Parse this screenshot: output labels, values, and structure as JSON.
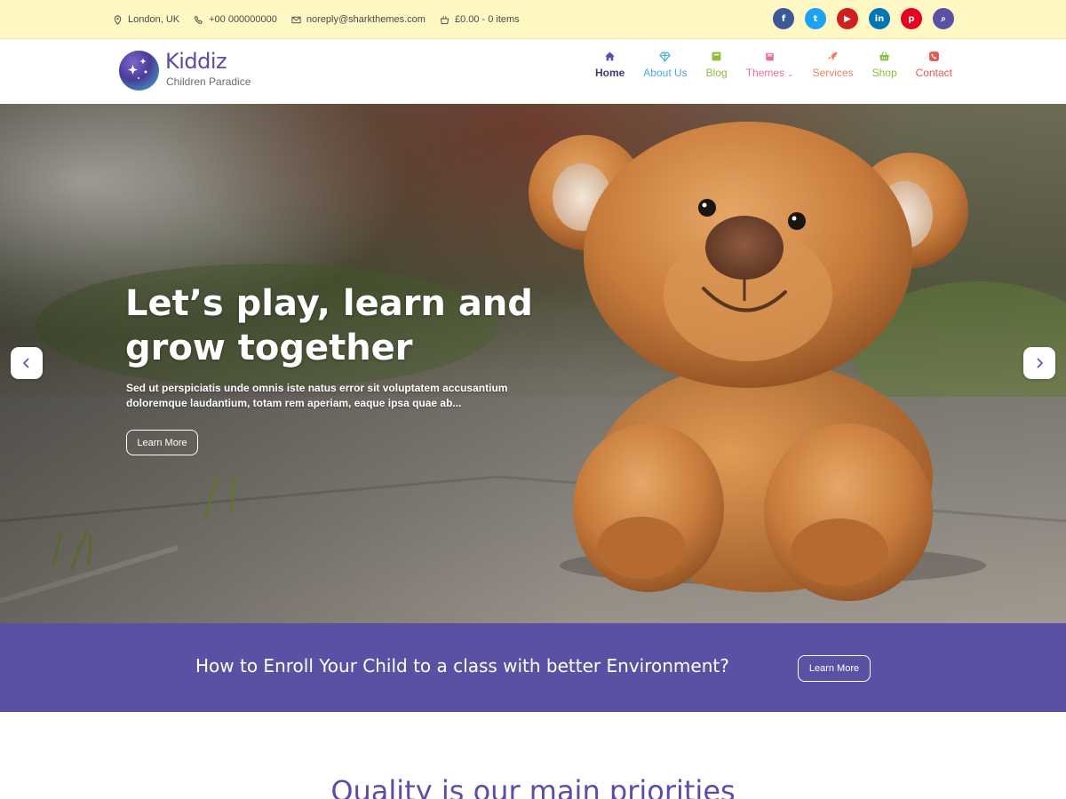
{
  "topbar": {
    "location": "London, UK",
    "phone": "+00 000000000",
    "email": "noreply@sharkthemes.com",
    "cart": "£0.00 - 0 items",
    "socials": [
      {
        "name": "facebook",
        "glyph": "f",
        "color": "#3b5998"
      },
      {
        "name": "twitter",
        "glyph": "t",
        "color": "#1da1f2"
      },
      {
        "name": "youtube",
        "glyph": "▶",
        "color": "#cd201f"
      },
      {
        "name": "linkedin",
        "glyph": "in",
        "color": "#0077b5"
      },
      {
        "name": "pinterest",
        "glyph": "p",
        "color": "#e60023"
      },
      {
        "name": "search",
        "glyph": "⌕",
        "color": "#5b51a4"
      }
    ]
  },
  "brand": {
    "title": "Kiddiz",
    "subtitle": "Children Paradice"
  },
  "nav": {
    "items": [
      {
        "label": "Home",
        "icon": "home-icon",
        "color": "#3d3a73"
      },
      {
        "label": "About Us",
        "icon": "diamond-icon",
        "color": "#4aa9d9"
      },
      {
        "label": "Blog",
        "icon": "blog-icon",
        "color": "#8bbf3c"
      },
      {
        "label": "Themes",
        "icon": "book-icon",
        "color": "#e7718f"
      },
      {
        "label": "Services",
        "icon": "rocket-icon",
        "color": "#e8845f"
      },
      {
        "label": "Shop",
        "icon": "basket-icon",
        "color": "#8bbf3c"
      },
      {
        "label": "Contact",
        "icon": "phone-icon",
        "color": "#e25a4f"
      }
    ]
  },
  "hero": {
    "title": "Let’s play, learn and grow together",
    "description": "Sed ut perspiciatis unde omnis iste natus error sit voluptatem accusantium doloremque laudantium, totam rem aperiam, eaque ipsa quae ab...",
    "button": "Learn More"
  },
  "cta": {
    "text": "How to Enroll Your Child to a class with better Environment?",
    "button": "Learn More",
    "color": "#5b51a4"
  },
  "section": {
    "title": "Quality is our main priorities"
  }
}
